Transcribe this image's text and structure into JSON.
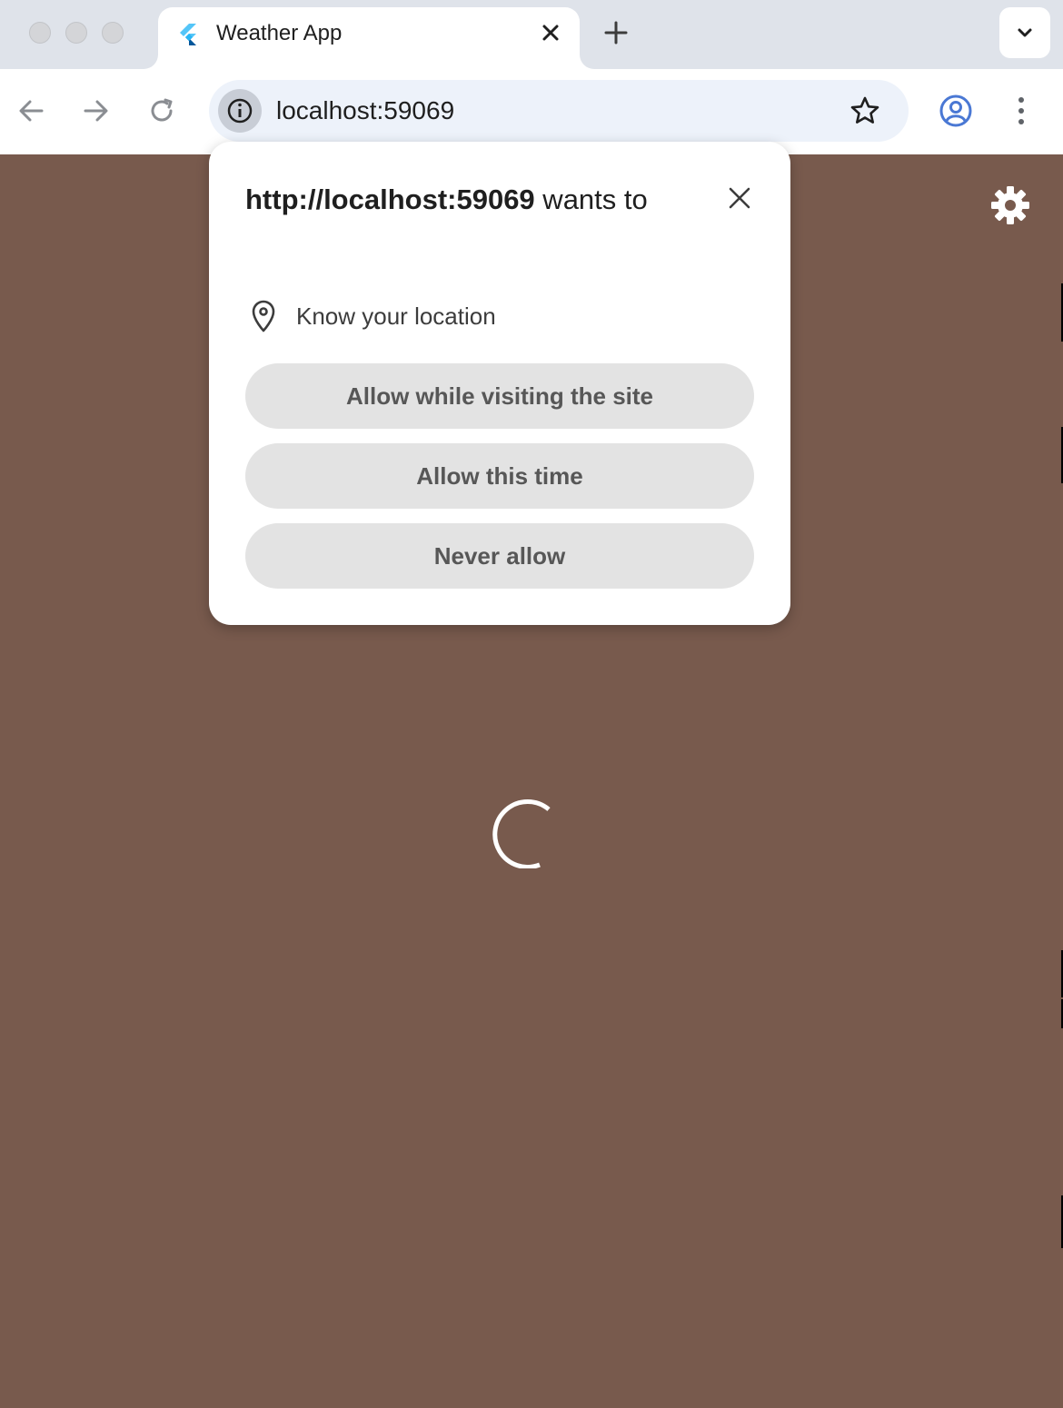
{
  "browser": {
    "tab": {
      "title": "Weather App",
      "favicon": "flutter-logo-icon"
    },
    "new_tab_icon": "plus-icon",
    "tab_search_icon": "chevron-down-icon",
    "address_bar": {
      "url": "localhost:59069",
      "site_info_icon": "info-icon",
      "bookmark_icon": "star-icon"
    },
    "profile_icon": "account-circle-icon",
    "menu_icon": "more-vert-icon"
  },
  "page": {
    "background_color": "#785a4d",
    "settings_icon": "gear-icon",
    "loading_indicator": "spinner"
  },
  "permission_prompt": {
    "title_origin": "http://localhost:59069",
    "title_suffix": " wants to",
    "permission_icon": "location-pin-icon",
    "permission_label": "Know your location",
    "buttons": {
      "allow_while_visiting": "Allow while visiting the site",
      "allow_this_time": "Allow this time",
      "never_allow": "Never allow"
    }
  },
  "colors": {
    "tabstrip": "#dfe3ea",
    "omnibox": "#edf2fa",
    "accent_blue": "#4a78d4",
    "button_bg": "#e3e3e3"
  }
}
